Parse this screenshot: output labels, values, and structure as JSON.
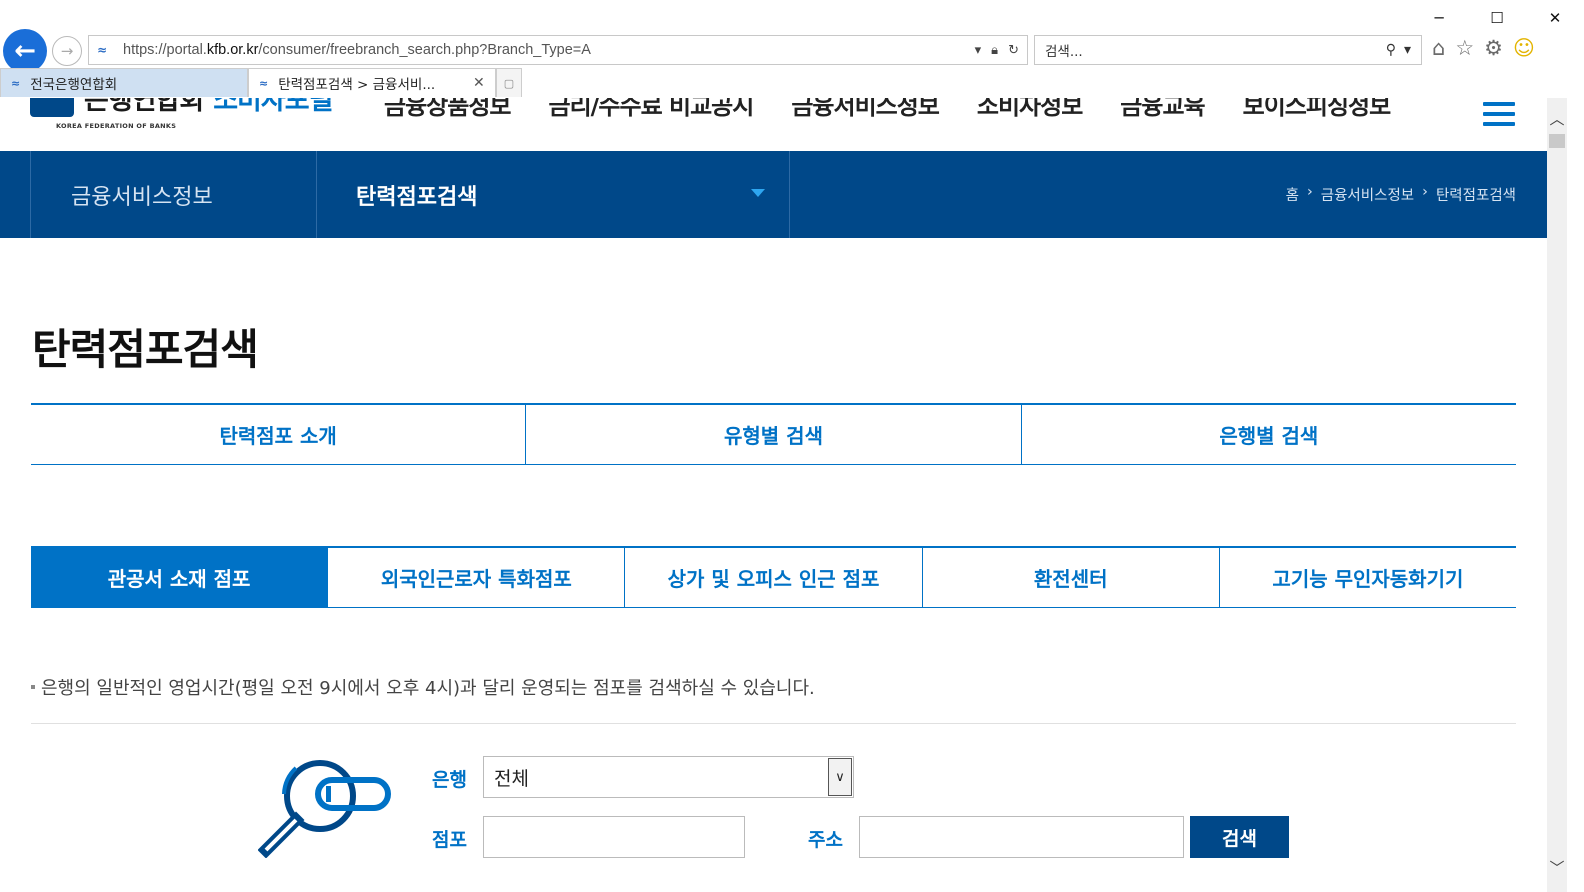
{
  "window": {
    "minimize": "─",
    "maximize": "☐",
    "close": "✕"
  },
  "browser": {
    "url_prefix": "https://portal.",
    "url_domain": "kfb.or.kr",
    "url_path": "/consumer/freebranch_search.php?Branch_Type=A",
    "search_placeholder": "검색...",
    "tabs": [
      {
        "label": "전국은행연합회"
      },
      {
        "label": "탄력점포검색 > 금융서비..."
      }
    ]
  },
  "header": {
    "logo_main": "은행연합회",
    "logo_sub": "소비자포털",
    "logo_en": "KOREA FEDERATION OF BANKS",
    "gnb": [
      "금융상품정보",
      "금리/수수료 비교공시",
      "금융서비스정보",
      "소비자정보",
      "금융교육",
      "보이스피싱정보"
    ]
  },
  "subnav": {
    "section": "금융서비스정보",
    "current": "탄력점포검색",
    "breadcrumb": [
      "홈",
      "금융서비스정보",
      "탄력점포검색"
    ]
  },
  "page": {
    "title": "탄력점포검색",
    "tabs1": [
      "탄력점포 소개",
      "유형별 검색",
      "은행별 검색"
    ],
    "tabs2": [
      "관공서 소재 점포",
      "외국인근로자 특화점포",
      "상가 및 오피스 인근 점포",
      "환전센터",
      "고기능 무인자동화기기"
    ],
    "active_tab2": 0,
    "description": "은행의 일반적인 영업시간(평일 오전 9시에서 오후 4시)과 달리 운영되는 점포를 검색하실 수 있습니다."
  },
  "form": {
    "bank_label": "은행",
    "bank_value": "전체",
    "branch_label": "점포",
    "branch_value": "",
    "address_label": "주소",
    "address_value": "",
    "search_button": "검색"
  },
  "colors": {
    "brand_navy": "#004889",
    "brand_blue": "#0072c6"
  }
}
